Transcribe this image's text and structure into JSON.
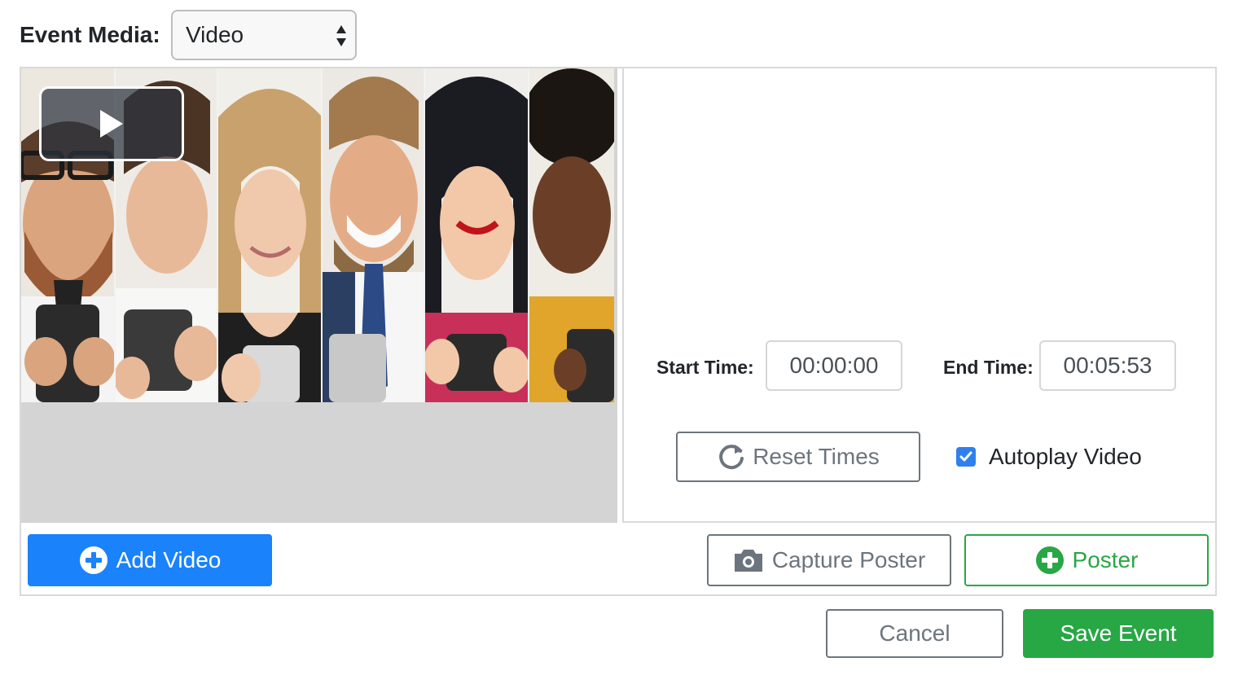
{
  "event_media": {
    "label": "Event Media:",
    "selected": "Video",
    "icon": "select-arrows-icon"
  },
  "video": {
    "play_icon": "play-icon",
    "poster_description_icon": "video-poster-image"
  },
  "times": {
    "start_label": "Start Time:",
    "start_value": "00:00:00",
    "end_label": "End Time:",
    "end_value": "00:05:53"
  },
  "reset": {
    "label": "Reset Times",
    "icon": "refresh-icon"
  },
  "autoplay": {
    "label": "Autoplay Video",
    "checked": true,
    "icon": "check-icon"
  },
  "buttons": {
    "add_video": "Add Video",
    "capture_poster": "Capture Poster",
    "poster": "Poster",
    "cancel": "Cancel",
    "save_event": "Save Event"
  },
  "colors": {
    "primary": "#1a82fb",
    "success": "#28a745",
    "secondary": "#6c757d",
    "video_bg": "#d4d4d4"
  }
}
